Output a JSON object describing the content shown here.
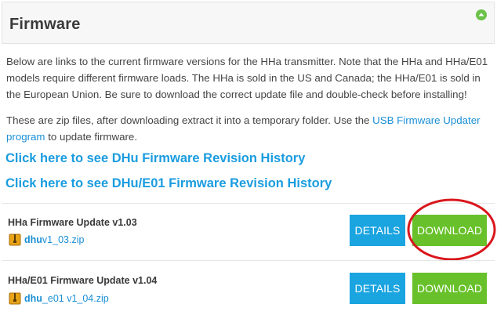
{
  "header": {
    "title": "Firmware",
    "collapse_icon": "up-arrow-circle-icon"
  },
  "intro": {
    "paragraph1": "Below are links to the current firmware versions for the HHa transmitter. Note that the HHa and HHa/E01 models require different firmware loads. The HHa is sold in the US and Canada; the HHa/E01 is sold in the European Union. Be sure to download the correct update file and double-check before installing!",
    "paragraph2_before": "These are zip files, after downloading extract it into a temporary folder. Use the ",
    "paragraph2_link": "USB Firmware Updater program",
    "paragraph2_after": " to update firmware."
  },
  "history_links": {
    "dhu": "Click here to see DHu Firmware Revision History",
    "dhu_e01": "Click here to see DHu/E01 Firmware Revision History"
  },
  "updates": [
    {
      "title": "HHa Firmware Update v1.03",
      "file_bold": "dhu",
      "file_rest": "v1_03.zip",
      "details_label": "DETAILS",
      "download_label": "DOWNLOAD"
    },
    {
      "title": "HHa/E01 Firmware Update v1.04",
      "file_bold": "dhu",
      "file_rest": "_e01 v1_04.zip",
      "details_label": "DETAILS",
      "download_label": "DOWNLOAD"
    }
  ],
  "colors": {
    "link_blue": "#1a8fd6",
    "details_blue": "#1aa4e0",
    "download_green": "#68c12a",
    "highlight_red": "#d9161c"
  }
}
